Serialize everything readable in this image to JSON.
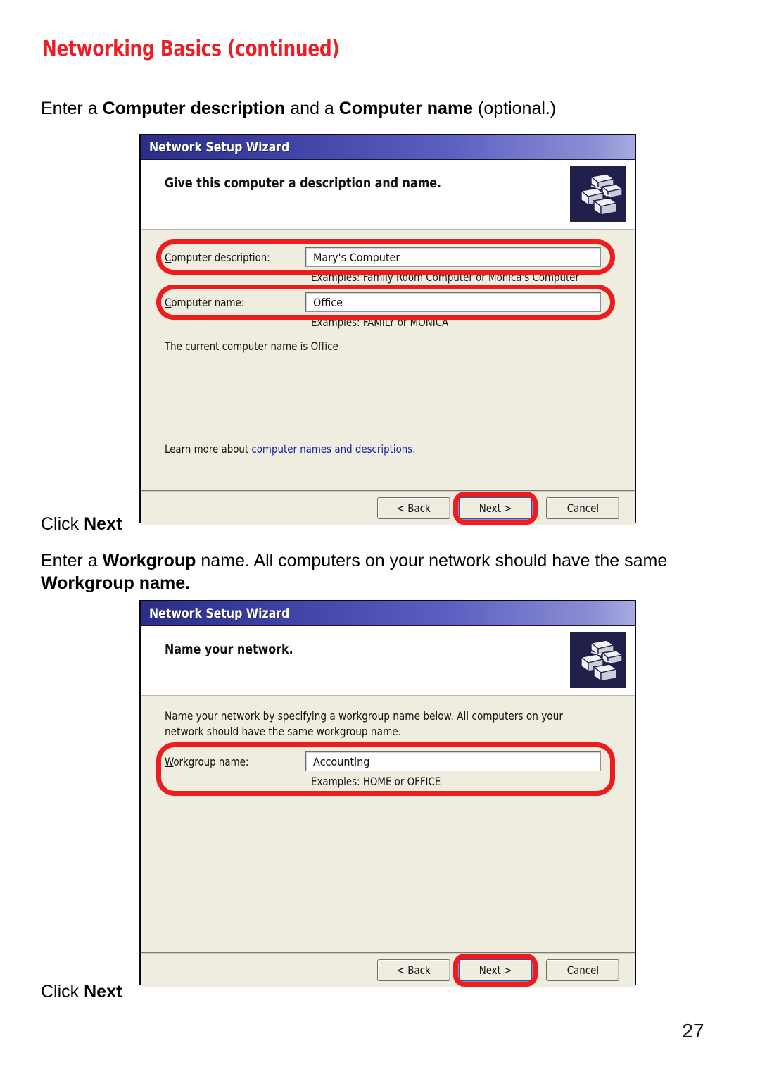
{
  "page": {
    "title": "Networking Basics (continued)",
    "number": "27"
  },
  "instructions": {
    "first_prefix": "Enter a ",
    "first_bold_1": "Computer description",
    "first_mid": " and a ",
    "first_bold_2": "Computer name",
    "first_suffix": " (optional.)",
    "click_next_prefix": "Click ",
    "click_next_bold": "Next",
    "second_prefix": "Enter a ",
    "second_bold_1": "Workgroup",
    "second_mid": " name.  All computers on your network should have the same ",
    "second_bold_2": "Workgroup name."
  },
  "dialog1": {
    "titlebar": "Network Setup Wizard",
    "heading": "Give this computer a description and name.",
    "icon": "network-computers-icon",
    "fields": [
      {
        "label_accel": "C",
        "label_rest": "omputer description:",
        "value": "Mary's Computer",
        "hint": "Examples: Family Room Computer or Monica's Computer"
      },
      {
        "label_accel": "C",
        "label_rest": "omputer name:",
        "value": "Office",
        "hint": "Examples: FAMILY or MONICA"
      }
    ],
    "current_name_text": "The current computer name is Office",
    "learn_more_prefix": "Learn more about ",
    "learn_more_link": "computer names and descriptions",
    "learn_more_suffix": ".",
    "buttons": {
      "back_pre": "< ",
      "back_accel": "B",
      "back_rest": "ack",
      "next_accel": "N",
      "next_rest": "ext >",
      "cancel": "Cancel"
    }
  },
  "dialog2": {
    "titlebar": "Network Setup Wizard",
    "heading": "Name your network.",
    "icon": "network-computers-icon",
    "body_text": "Name your network by specifying a workgroup name below. All computers on your network should have the same workgroup name.",
    "field": {
      "label_accel": "W",
      "label_rest": "orkgroup name:",
      "value": "Accounting",
      "hint": "Examples: HOME or OFFICE"
    },
    "buttons": {
      "back_pre": "< ",
      "back_accel": "B",
      "back_rest": "ack",
      "next_accel": "N",
      "next_rest": "ext >",
      "cancel": "Cancel"
    }
  },
  "colors": {
    "accent_red": "#ee1c25",
    "annotation_red": "#ee1c1c",
    "dialog_bg": "#EFEDE0",
    "titlebar_blue": "#3a3ca0",
    "link_blue": "#1a1aa8"
  }
}
